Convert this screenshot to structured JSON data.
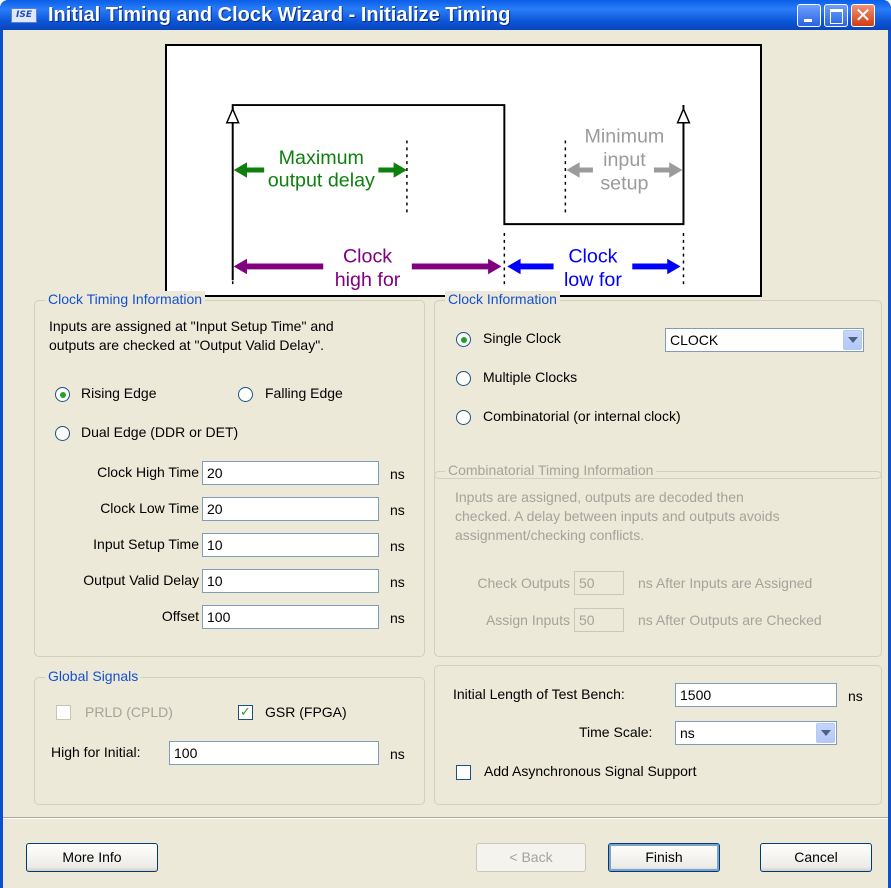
{
  "window": {
    "title": "Initial Timing and Clock Wizard - Initialize Timing",
    "app_icon": "ISE"
  },
  "diagram": {
    "max_output_delay": [
      "Maximum",
      "output delay"
    ],
    "min_input_setup": [
      "Minimum",
      "input",
      "setup"
    ],
    "clock_high_for": [
      "Clock",
      "high for"
    ],
    "clock_low_for": [
      "Clock",
      "low for"
    ],
    "colors": {
      "green": "#0f7f0f",
      "gray": "#9b9b9b",
      "purple": "#800080",
      "blue": "#0000ff"
    }
  },
  "clock_timing": {
    "title": "Clock Timing Information",
    "desc_line1": "Inputs are assigned at \"Input Setup Time\" and",
    "desc_line2": "outputs are checked at \"Output Valid Delay\".",
    "rising_edge": "Rising Edge",
    "falling_edge": "Falling Edge",
    "dual_edge": "Dual Edge (DDR or DET)",
    "selected_edge": "Rising Edge",
    "fields": [
      {
        "label": "Clock High Time",
        "value": "20",
        "unit": "ns"
      },
      {
        "label": "Clock Low Time",
        "value": "20",
        "unit": "ns"
      },
      {
        "label": "Input Setup Time",
        "value": "10",
        "unit": "ns"
      },
      {
        "label": "Output Valid Delay",
        "value": "10",
        "unit": "ns"
      },
      {
        "label": "Offset",
        "value": "100",
        "unit": "ns"
      }
    ]
  },
  "clock_info": {
    "title": "Clock Information",
    "single_clock": "Single Clock",
    "multiple_clocks": "Multiple Clocks",
    "combinatorial": "Combinatorial (or internal clock)",
    "clock_select": "CLOCK"
  },
  "comb_timing": {
    "title": "Combinatorial Timing Information",
    "desc_line1": "Inputs are assigned, outputs are decoded then",
    "desc_line2": "checked.  A delay between inputs and outputs avoids",
    "desc_line3": "assignment/checking conflicts.",
    "check_outputs_label": "Check Outputs",
    "check_outputs_value": "50",
    "check_outputs_suffix": "ns  After Inputs are Assigned",
    "assign_inputs_label": "Assign Inputs",
    "assign_inputs_value": "50",
    "assign_inputs_suffix": "ns  After Outputs are Checked"
  },
  "global_signals": {
    "title": "Global Signals",
    "prld_label": "PRLD (CPLD)",
    "gsr_label": "GSR (FPGA)",
    "high_for_initial_label": "High for Initial:",
    "high_for_initial_value": "100",
    "unit": "ns"
  },
  "test_bench": {
    "length_label": "Initial Length of Test Bench:",
    "length_value": "1500",
    "length_unit": "ns",
    "time_scale_label": "Time Scale:",
    "time_scale_value": "ns",
    "async_label": "Add Asynchronous Signal Support"
  },
  "buttons": {
    "more_info": "More Info",
    "back": "< Back",
    "finish": "Finish",
    "cancel": "Cancel"
  }
}
